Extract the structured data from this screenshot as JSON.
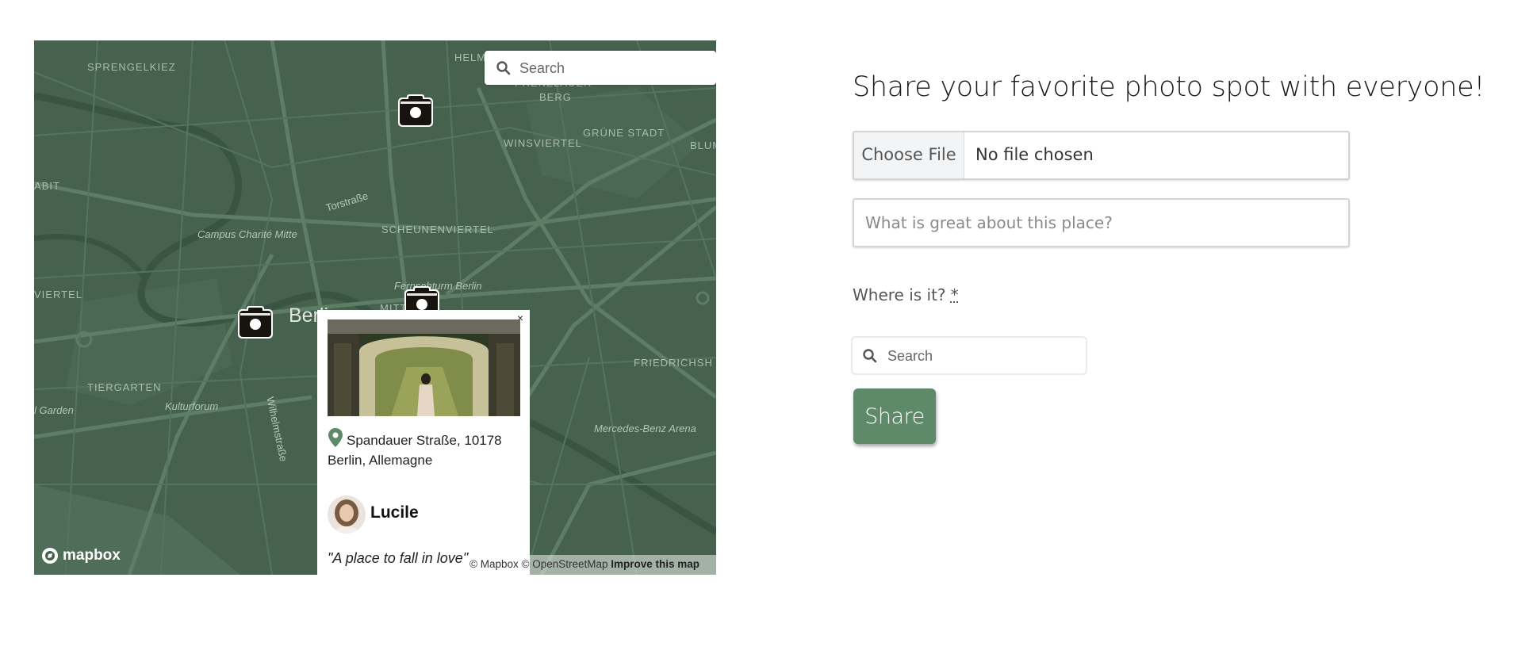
{
  "map": {
    "search_placeholder": "Search",
    "labels": {
      "sprengelkiez": "SPRENGELKIEZ",
      "helm": "HELM",
      "prenzlauer": "PRENZLAUER",
      "berg": "BERG",
      "gruene_stadt": "GRÜNE STADT",
      "winsviertel": "WINSVIERTEL",
      "blum": "BLUM",
      "abit": "ABIT",
      "torstrasse": "Torstraße",
      "campus": "Campus Charité Mitte",
      "scheunenviertel": "SCHEUNENVIERTEL",
      "fernsehturm": "Fernsehturm Berlin",
      "viertel": "VIERTEL",
      "berlin": "Berlin",
      "mitte": "MITTE",
      "friedrichshain": "FRIEDRICHSH",
      "tiergarten": "TIERGARTEN",
      "kulturforum": "Kulturforum",
      "wilhelmstrasse": "Wilhelmstraße",
      "garden": "l Garden",
      "mercedes": "Mercedes-Benz Arena"
    },
    "popup": {
      "close": "×",
      "address": "Spandauer Straße, 10178 Berlin, Allemagne",
      "username": "Lucile",
      "quote": "\"A place to fall in love\""
    },
    "logo_text": "mapbox",
    "attribution": {
      "mapbox": "© Mapbox",
      "osm": "© OpenStreetMap",
      "improve": "Improve this map"
    },
    "colors": {
      "base": "#46624f",
      "road": "#5e7d66",
      "river": "#3a5444"
    }
  },
  "form": {
    "title": "Share your favorite photo spot with everyone!",
    "file_button": "Choose File",
    "file_status": "No file chosen",
    "description_placeholder": "What is great about this place?",
    "location_label": "Where is it?",
    "required_marker": "*",
    "location_search_placeholder": "Search",
    "submit_label": "Share",
    "accent_color": "#5f8a6a"
  }
}
